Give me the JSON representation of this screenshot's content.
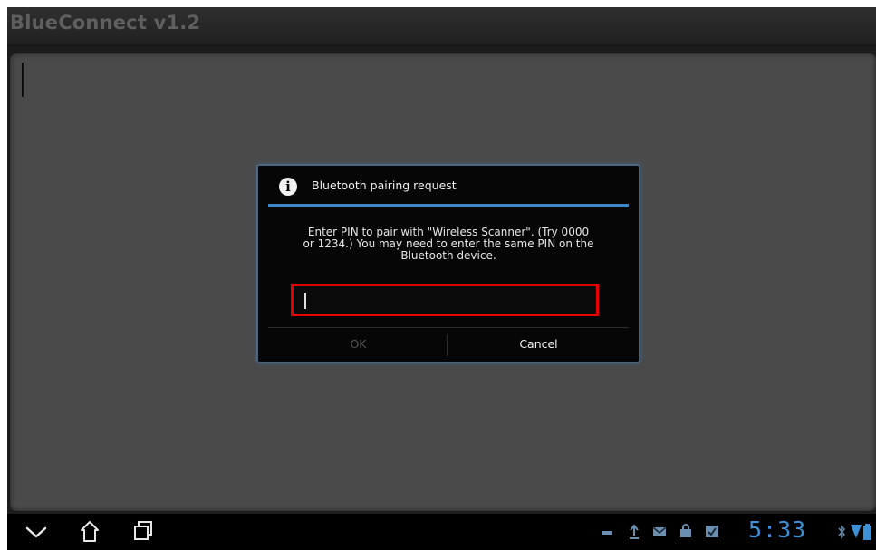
{
  "app": {
    "title": "BlueConnect v1.2"
  },
  "dialog": {
    "title": "Bluetooth pairing request",
    "message_lines": [
      "Enter PIN to pair with \"Wireless Scanner\". (Try 0000",
      "or 1234.) You may need to enter the same PIN on the",
      "Bluetooth device."
    ],
    "pin_value": "",
    "ok_label": "OK",
    "cancel_label": "Cancel"
  },
  "navbar": {
    "buttons": [
      "back-icon",
      "home-icon",
      "recent-apps-icon"
    ]
  },
  "status_bar": {
    "icons": [
      "usb-icon",
      "upload-icon",
      "mail-icon",
      "lock-icon",
      "clipboard-check-icon",
      "bluetooth-icon",
      "wifi-icon",
      "battery-icon"
    ],
    "clock": "5:33"
  },
  "colors": {
    "accent": "#3f86c8",
    "clock": "#3d8fd6",
    "highlight_box": "#e60000",
    "dialog_border": "#4d6680"
  }
}
